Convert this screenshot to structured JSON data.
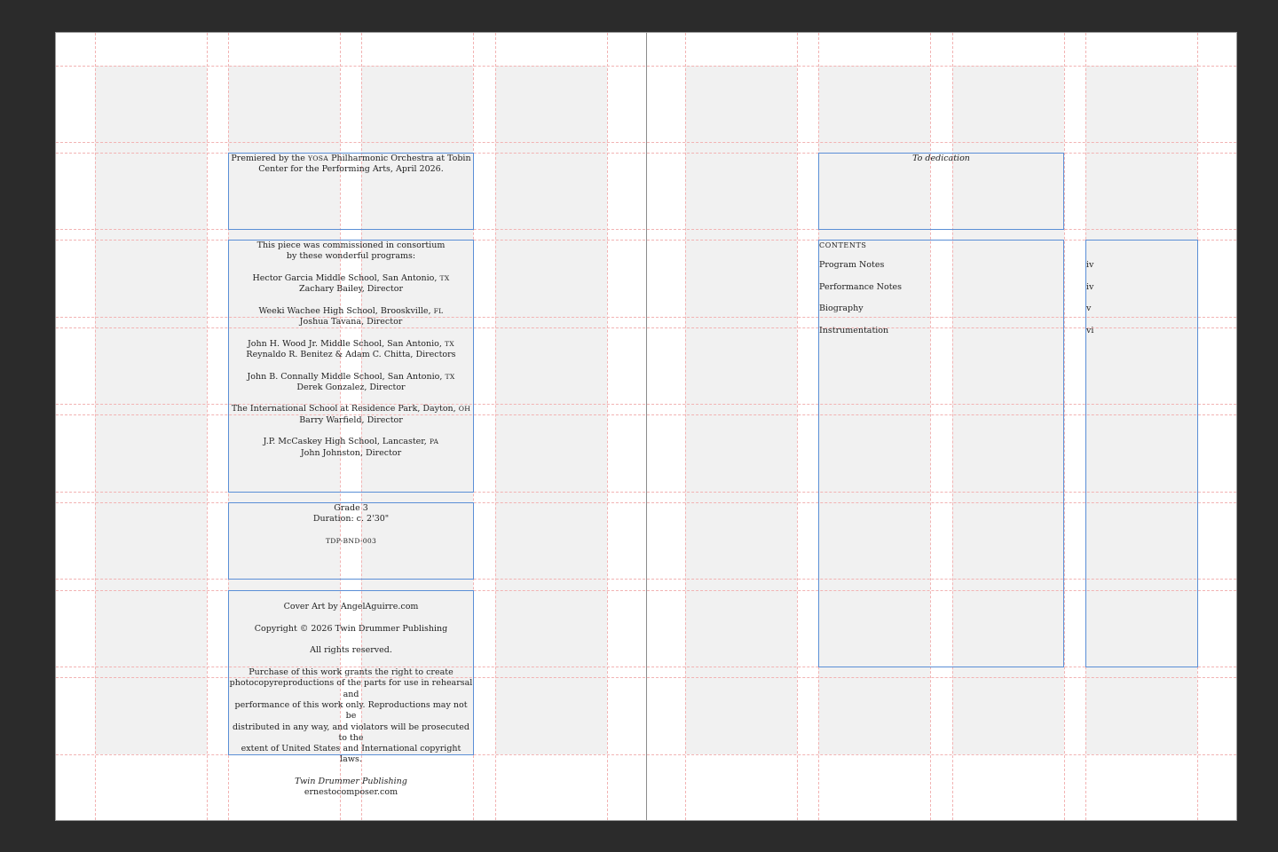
{
  "premiere": {
    "prefix": "Premiered by the ",
    "ensemble_sc": "YOSA",
    "line1_rest": " Philharmonic Orchestra at Tobin",
    "line2": "Center for the Performing Arts, April 2026."
  },
  "commission": {
    "intro_line1": "This piece was commissioned in consortium",
    "intro_line2": "by these wonderful programs:",
    "programs": [
      {
        "school": "Hector Garcia Middle School, San Antonio, ",
        "state": "TX",
        "director": "Zachary Bailey, Director"
      },
      {
        "school": "Weeki Wachee High School, Brooskville, ",
        "state": "FL",
        "director": "Joshua Tavana, Director"
      },
      {
        "school": "John H. Wood Jr. Middle School, San Antonio, ",
        "state": "TX",
        "director": "Reynaldo R. Benitez & Adam C. Chitta, Directors"
      },
      {
        "school": "John B. Connally Middle School, San Antonio, ",
        "state": "TX",
        "director": "Derek Gonzalez, Director"
      },
      {
        "school": "The International School at Residence Park, Dayton, ",
        "state": "OH",
        "director": "Barry Warfield, Director"
      },
      {
        "school": "J.P. McCaskey High School, Lancaster, ",
        "state": "PA",
        "director": "John Johnston, Director"
      }
    ]
  },
  "details": {
    "grade": "Grade 3",
    "duration": "Duration: c. 2'30\"",
    "catalog": "TDP-BND-003"
  },
  "copyright": {
    "cover_art": "Cover Art by AngelAguirre.com",
    "copyright_line": "Copyright © 2026 Twin Drummer Publishing",
    "rights": "All rights reserved.",
    "license_lines": [
      "Purchase of this work grants the right to create",
      "photocopyreproductions of the parts for use in rehearsal and",
      "performance of this work only. Reproductions may not be",
      "distributed in any way, and violators will be prosecuted to the",
      "extent of United States and International copyright laws."
    ],
    "publisher": "Twin Drummer Publishing",
    "website": "ernestocomposer.com"
  },
  "dedication": {
    "text": "To dedication"
  },
  "contents": {
    "heading": "CONTENTS",
    "items": [
      {
        "label": "Program Notes",
        "page": "iv"
      },
      {
        "label": "Performance Notes",
        "page": "iv"
      },
      {
        "label": "Biography",
        "page": "v"
      },
      {
        "label": "Instrumentation",
        "page": "vi"
      }
    ]
  },
  "colors": {
    "frame_border": "#5b8fd6",
    "guide": "#f2b3b3",
    "column_fill": "#f1f1f1",
    "pasteboard": "#2b2b2b"
  }
}
